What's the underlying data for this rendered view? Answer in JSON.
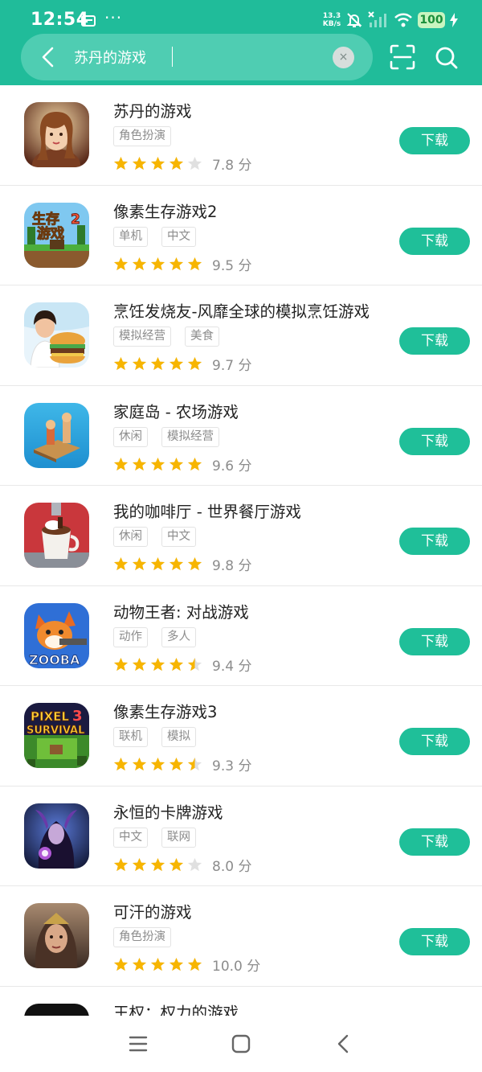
{
  "status_bar": {
    "time": "12:54",
    "more": "···",
    "net_speed_value": "13.3",
    "net_speed_unit": "KB/s",
    "battery": "100",
    "icons": [
      "sim-card-icon",
      "mute-bell-icon",
      "signal-off-icon",
      "wifi-icon",
      "battery-icon",
      "charging-icon"
    ]
  },
  "search": {
    "query": "苏丹的游戏",
    "clear": "×"
  },
  "colors": {
    "header": "#20bc9a",
    "button": "#1fbf99",
    "star": "#f7b500",
    "star_empty": "#e0e0e0"
  },
  "apps": [
    {
      "name": "苏丹的游戏",
      "tags": [
        "角色扮演"
      ],
      "stars": 4,
      "score": "7.8 分",
      "button": "下载"
    },
    {
      "name": "像素生存游戏2",
      "tags": [
        "单机",
        "中文"
      ],
      "stars": 5,
      "score": "9.5 分",
      "button": "下载"
    },
    {
      "name": "烹饪发烧友-风靡全球的模拟烹饪游戏",
      "tags": [
        "模拟经营",
        "美食"
      ],
      "stars": 5,
      "score": "9.7 分",
      "button": "下载"
    },
    {
      "name": "家庭岛 - 农场游戏",
      "tags": [
        "休闲",
        "模拟经营"
      ],
      "stars": 5,
      "score": "9.6 分",
      "button": "下载"
    },
    {
      "name": "我的咖啡厅 - 世界餐厅游戏",
      "tags": [
        "休闲",
        "中文"
      ],
      "stars": 5,
      "score": "9.8 分",
      "button": "下载"
    },
    {
      "name": "动物王者: 对战游戏",
      "tags": [
        "动作",
        "多人"
      ],
      "stars": 4.5,
      "score": "9.4 分",
      "button": "下载"
    },
    {
      "name": "像素生存游戏3",
      "tags": [
        "联机",
        "模拟"
      ],
      "stars": 4.5,
      "score": "9.3 分",
      "button": "下载"
    },
    {
      "name": "永恒的卡牌游戏",
      "tags": [
        "中文",
        "联网"
      ],
      "stars": 4,
      "score": "8.0 分",
      "button": "下载"
    },
    {
      "name": "可汗的游戏",
      "tags": [
        "角色扮演"
      ],
      "stars": 5,
      "score": "10.0 分",
      "button": "下载"
    }
  ],
  "partial_app": {
    "name": "王权：权力的游戏"
  },
  "icon_text": {
    "app2_line1": "生存",
    "app2_line2": "游戏",
    "app2_num": "2",
    "app6_logo": "ZOOBA",
    "app7_line1": "PIXEL",
    "app7_line2": "SURVIVAL",
    "app7_num": "3"
  },
  "nav_bar": {
    "icons": [
      "menu-icon",
      "home-icon",
      "back-icon"
    ]
  }
}
